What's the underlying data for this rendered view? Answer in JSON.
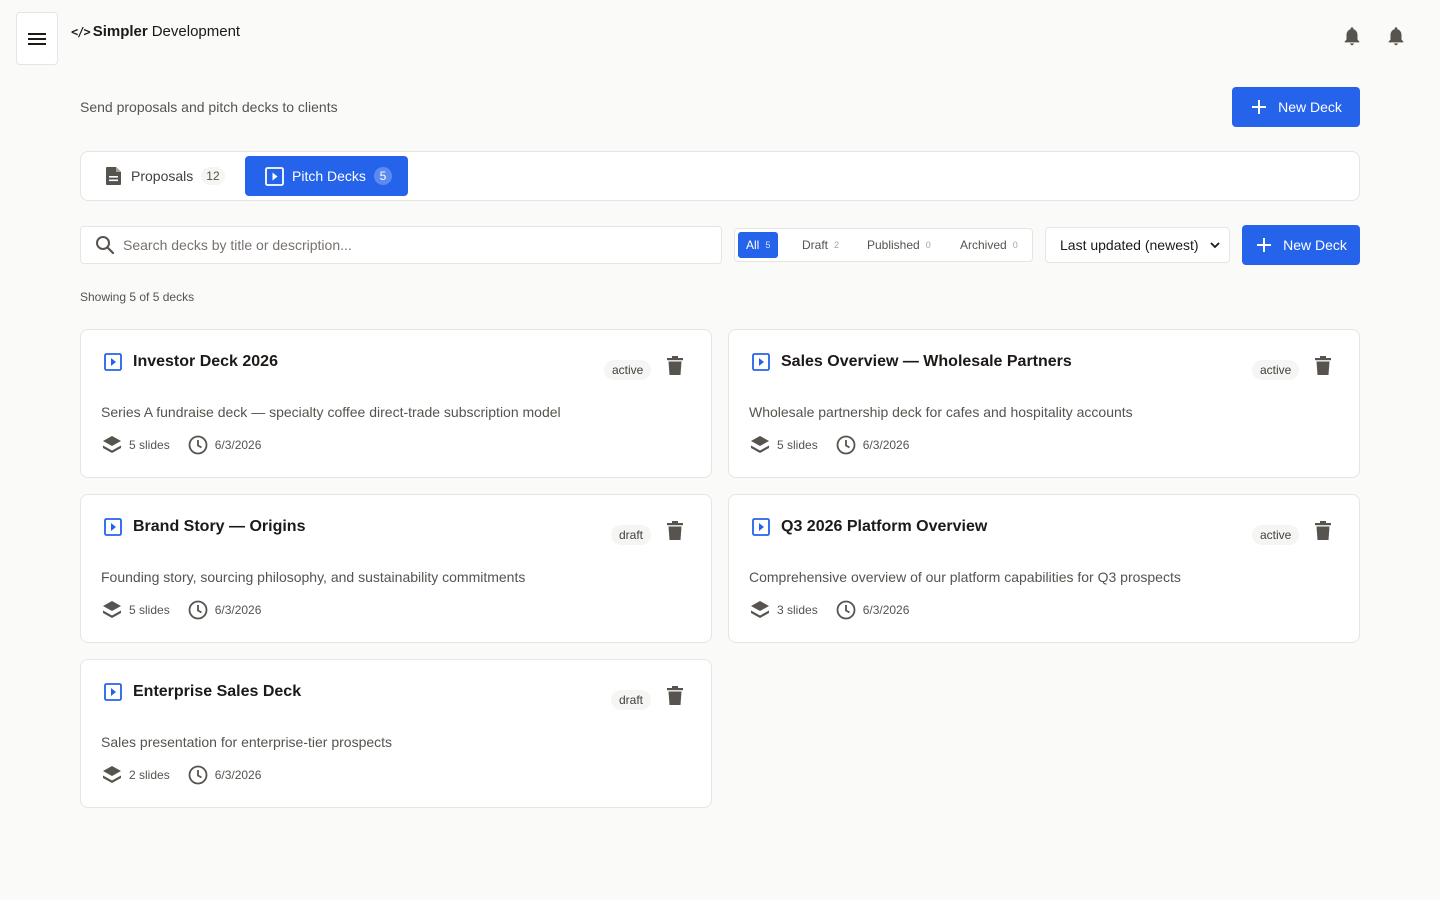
{
  "brand": {
    "glyph": "</>",
    "name_bold": "Simpler",
    "name_rest": "Development"
  },
  "header": {
    "subtitle": "Send proposals and pitch decks to clients",
    "new_deck_label": "New Deck"
  },
  "tabs": [
    {
      "label": "Proposals",
      "count": "12",
      "icon": "document-icon"
    },
    {
      "label": "Pitch Decks",
      "count": "5",
      "icon": "play-icon",
      "active": true
    }
  ],
  "search": {
    "placeholder": "Search decks by title or description...",
    "value": ""
  },
  "filters": [
    {
      "label": "All",
      "count": "5",
      "active": true
    },
    {
      "label": "Draft",
      "count": "2"
    },
    {
      "label": "Published",
      "count": "0"
    },
    {
      "label": "Archived",
      "count": "0"
    }
  ],
  "sort": {
    "selected": "Last updated (newest)"
  },
  "toolbar": {
    "new_deck_label": "New Deck"
  },
  "showing": "Showing 5 of 5 decks",
  "decks": [
    {
      "title": "Investor Deck 2026",
      "status": "active",
      "description": "Series A fundraise deck — specialty coffee direct-trade subscription model",
      "slides": "5 slides",
      "date": "6/3/2026"
    },
    {
      "title": "Sales Overview — Wholesale Partners",
      "status": "active",
      "description": "Wholesale partnership deck for cafes and hospitality accounts",
      "slides": "5 slides",
      "date": "6/3/2026"
    },
    {
      "title": "Brand Story — Origins",
      "status": "draft",
      "description": "Founding story, sourcing philosophy, and sustainability commitments",
      "slides": "5 slides",
      "date": "6/3/2026"
    },
    {
      "title": "Q3 2026 Platform Overview",
      "status": "active",
      "description": "Comprehensive overview of our platform capabilities for Q3 prospects",
      "slides": "3 slides",
      "date": "6/3/2026"
    },
    {
      "title": "Enterprise Sales Deck",
      "status": "draft",
      "description": "Sales presentation for enterprise-tier prospects",
      "slides": "2 slides",
      "date": "6/3/2026"
    }
  ],
  "colors": {
    "primary": "#2563eb",
    "background": "#fafaf9",
    "border": "#e7e5e4",
    "icon_gray": "#57534e"
  }
}
